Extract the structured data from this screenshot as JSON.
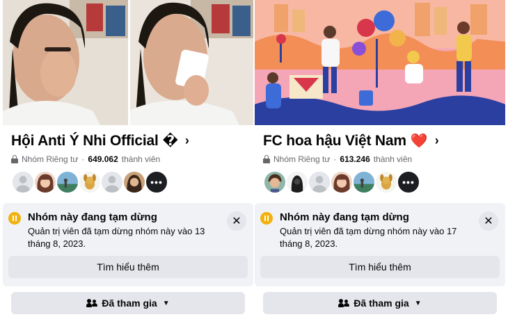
{
  "panels": [
    {
      "group_name": "Hội Anti Ý Nhi Official",
      "title_emoji": "�",
      "chevron": "›",
      "privacy": "Nhóm Riêng tư",
      "dot": "·",
      "member_count": "649.062",
      "member_label": "thành viên",
      "avatars": [
        "default-avatar",
        "girl-avatar",
        "landscape-avatar",
        "dog-avatar",
        "default-avatar",
        "woman-avatar",
        "more"
      ],
      "more_label": "•••",
      "notice_title": "Nhóm này đang tạm dừng",
      "notice_desc": "Quản trị viên đã tạm dừng nhóm này vào 13 tháng 8, 2023.",
      "close_label": "✕",
      "learn_more": "Tìm hiểu thêm",
      "joined_label": "Đã tham gia",
      "caret": "▼"
    },
    {
      "group_name": "FC hoa hậu Việt Nam",
      "title_emoji": "❤️",
      "chevron": "›",
      "privacy": "Nhóm Riêng tư",
      "dot": "·",
      "member_count": "613.246",
      "member_label": "thành viên",
      "avatars": [
        "man-avatar",
        "dark-avatar",
        "default-avatar",
        "girl-avatar",
        "landscape-avatar",
        "dog-avatar",
        "more"
      ],
      "more_label": "•••",
      "notice_title": "Nhóm này đang tạm dừng",
      "notice_desc": "Quản trị viên đã tạm dừng nhóm này vào 17 tháng 8, 2023.",
      "close_label": "✕",
      "learn_more": "Tìm hiểu thêm",
      "joined_label": "Đã tham gia",
      "caret": "▼"
    }
  ],
  "colors": {
    "pause_icon": "#f2b10f",
    "notice_bg": "#f0f2f5",
    "button_bg": "#e4e6eb",
    "cover_right_bg": "#f4a6b6"
  }
}
